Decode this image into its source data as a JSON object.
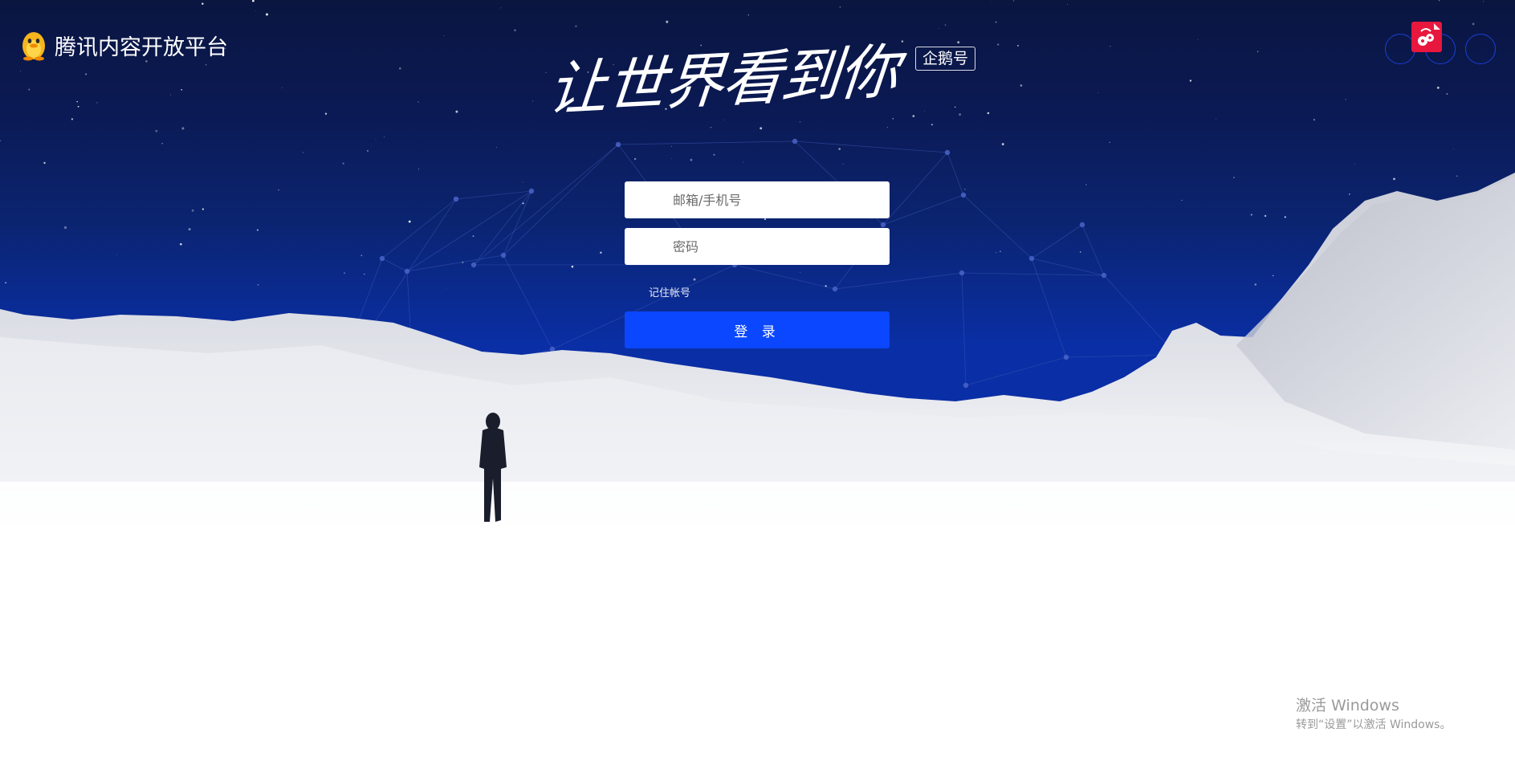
{
  "brand": {
    "logo_icon": "qq-penguin-icon",
    "name": "腾讯内容开放平台"
  },
  "hero": {
    "slogan": "让世界看到你",
    "badge": "企鹅号"
  },
  "top_right": {
    "icons": [
      "circle-icon",
      "weibo-icon",
      "circle-icon"
    ]
  },
  "login_form": {
    "account_placeholder": "邮箱/手机号",
    "password_placeholder": "密码",
    "remember_label": "记住帐号",
    "submit_label": "登 录"
  },
  "windows_watermark": {
    "title": "激活 Windows",
    "subtitle": "转到“设置”以激活 Windows。"
  },
  "colors": {
    "sky_top": "#0a1540",
    "sky_bottom": "#0a2ea5",
    "button": "#0a47ff",
    "weibo_red": "#e8173d"
  }
}
